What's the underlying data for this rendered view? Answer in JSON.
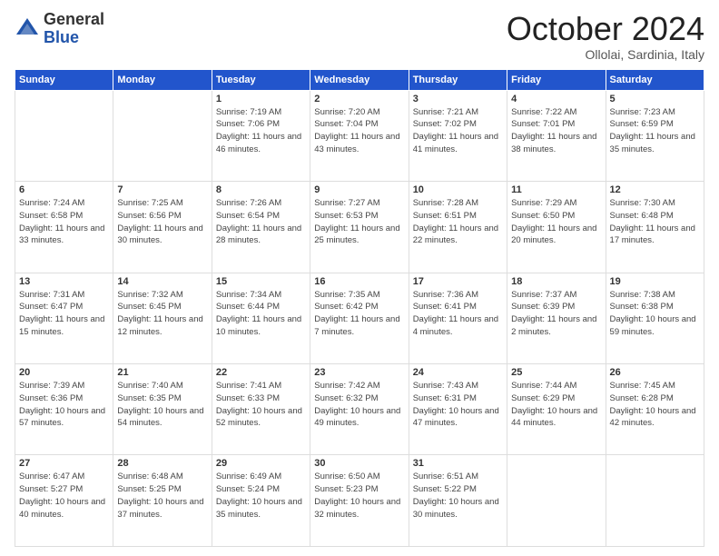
{
  "logo": {
    "general": "General",
    "blue": "Blue"
  },
  "header": {
    "month": "October 2024",
    "location": "Ollolai, Sardinia, Italy"
  },
  "days_of_week": [
    "Sunday",
    "Monday",
    "Tuesday",
    "Wednesday",
    "Thursday",
    "Friday",
    "Saturday"
  ],
  "weeks": [
    [
      {
        "day": null
      },
      {
        "day": null
      },
      {
        "day": "1",
        "sunrise": "Sunrise: 7:19 AM",
        "sunset": "Sunset: 7:06 PM",
        "daylight": "Daylight: 11 hours and 46 minutes."
      },
      {
        "day": "2",
        "sunrise": "Sunrise: 7:20 AM",
        "sunset": "Sunset: 7:04 PM",
        "daylight": "Daylight: 11 hours and 43 minutes."
      },
      {
        "day": "3",
        "sunrise": "Sunrise: 7:21 AM",
        "sunset": "Sunset: 7:02 PM",
        "daylight": "Daylight: 11 hours and 41 minutes."
      },
      {
        "day": "4",
        "sunrise": "Sunrise: 7:22 AM",
        "sunset": "Sunset: 7:01 PM",
        "daylight": "Daylight: 11 hours and 38 minutes."
      },
      {
        "day": "5",
        "sunrise": "Sunrise: 7:23 AM",
        "sunset": "Sunset: 6:59 PM",
        "daylight": "Daylight: 11 hours and 35 minutes."
      }
    ],
    [
      {
        "day": "6",
        "sunrise": "Sunrise: 7:24 AM",
        "sunset": "Sunset: 6:58 PM",
        "daylight": "Daylight: 11 hours and 33 minutes."
      },
      {
        "day": "7",
        "sunrise": "Sunrise: 7:25 AM",
        "sunset": "Sunset: 6:56 PM",
        "daylight": "Daylight: 11 hours and 30 minutes."
      },
      {
        "day": "8",
        "sunrise": "Sunrise: 7:26 AM",
        "sunset": "Sunset: 6:54 PM",
        "daylight": "Daylight: 11 hours and 28 minutes."
      },
      {
        "day": "9",
        "sunrise": "Sunrise: 7:27 AM",
        "sunset": "Sunset: 6:53 PM",
        "daylight": "Daylight: 11 hours and 25 minutes."
      },
      {
        "day": "10",
        "sunrise": "Sunrise: 7:28 AM",
        "sunset": "Sunset: 6:51 PM",
        "daylight": "Daylight: 11 hours and 22 minutes."
      },
      {
        "day": "11",
        "sunrise": "Sunrise: 7:29 AM",
        "sunset": "Sunset: 6:50 PM",
        "daylight": "Daylight: 11 hours and 20 minutes."
      },
      {
        "day": "12",
        "sunrise": "Sunrise: 7:30 AM",
        "sunset": "Sunset: 6:48 PM",
        "daylight": "Daylight: 11 hours and 17 minutes."
      }
    ],
    [
      {
        "day": "13",
        "sunrise": "Sunrise: 7:31 AM",
        "sunset": "Sunset: 6:47 PM",
        "daylight": "Daylight: 11 hours and 15 minutes."
      },
      {
        "day": "14",
        "sunrise": "Sunrise: 7:32 AM",
        "sunset": "Sunset: 6:45 PM",
        "daylight": "Daylight: 11 hours and 12 minutes."
      },
      {
        "day": "15",
        "sunrise": "Sunrise: 7:34 AM",
        "sunset": "Sunset: 6:44 PM",
        "daylight": "Daylight: 11 hours and 10 minutes."
      },
      {
        "day": "16",
        "sunrise": "Sunrise: 7:35 AM",
        "sunset": "Sunset: 6:42 PM",
        "daylight": "Daylight: 11 hours and 7 minutes."
      },
      {
        "day": "17",
        "sunrise": "Sunrise: 7:36 AM",
        "sunset": "Sunset: 6:41 PM",
        "daylight": "Daylight: 11 hours and 4 minutes."
      },
      {
        "day": "18",
        "sunrise": "Sunrise: 7:37 AM",
        "sunset": "Sunset: 6:39 PM",
        "daylight": "Daylight: 11 hours and 2 minutes."
      },
      {
        "day": "19",
        "sunrise": "Sunrise: 7:38 AM",
        "sunset": "Sunset: 6:38 PM",
        "daylight": "Daylight: 10 hours and 59 minutes."
      }
    ],
    [
      {
        "day": "20",
        "sunrise": "Sunrise: 7:39 AM",
        "sunset": "Sunset: 6:36 PM",
        "daylight": "Daylight: 10 hours and 57 minutes."
      },
      {
        "day": "21",
        "sunrise": "Sunrise: 7:40 AM",
        "sunset": "Sunset: 6:35 PM",
        "daylight": "Daylight: 10 hours and 54 minutes."
      },
      {
        "day": "22",
        "sunrise": "Sunrise: 7:41 AM",
        "sunset": "Sunset: 6:33 PM",
        "daylight": "Daylight: 10 hours and 52 minutes."
      },
      {
        "day": "23",
        "sunrise": "Sunrise: 7:42 AM",
        "sunset": "Sunset: 6:32 PM",
        "daylight": "Daylight: 10 hours and 49 minutes."
      },
      {
        "day": "24",
        "sunrise": "Sunrise: 7:43 AM",
        "sunset": "Sunset: 6:31 PM",
        "daylight": "Daylight: 10 hours and 47 minutes."
      },
      {
        "day": "25",
        "sunrise": "Sunrise: 7:44 AM",
        "sunset": "Sunset: 6:29 PM",
        "daylight": "Daylight: 10 hours and 44 minutes."
      },
      {
        "day": "26",
        "sunrise": "Sunrise: 7:45 AM",
        "sunset": "Sunset: 6:28 PM",
        "daylight": "Daylight: 10 hours and 42 minutes."
      }
    ],
    [
      {
        "day": "27",
        "sunrise": "Sunrise: 6:47 AM",
        "sunset": "Sunset: 5:27 PM",
        "daylight": "Daylight: 10 hours and 40 minutes."
      },
      {
        "day": "28",
        "sunrise": "Sunrise: 6:48 AM",
        "sunset": "Sunset: 5:25 PM",
        "daylight": "Daylight: 10 hours and 37 minutes."
      },
      {
        "day": "29",
        "sunrise": "Sunrise: 6:49 AM",
        "sunset": "Sunset: 5:24 PM",
        "daylight": "Daylight: 10 hours and 35 minutes."
      },
      {
        "day": "30",
        "sunrise": "Sunrise: 6:50 AM",
        "sunset": "Sunset: 5:23 PM",
        "daylight": "Daylight: 10 hours and 32 minutes."
      },
      {
        "day": "31",
        "sunrise": "Sunrise: 6:51 AM",
        "sunset": "Sunset: 5:22 PM",
        "daylight": "Daylight: 10 hours and 30 minutes."
      },
      {
        "day": null
      },
      {
        "day": null
      }
    ]
  ]
}
